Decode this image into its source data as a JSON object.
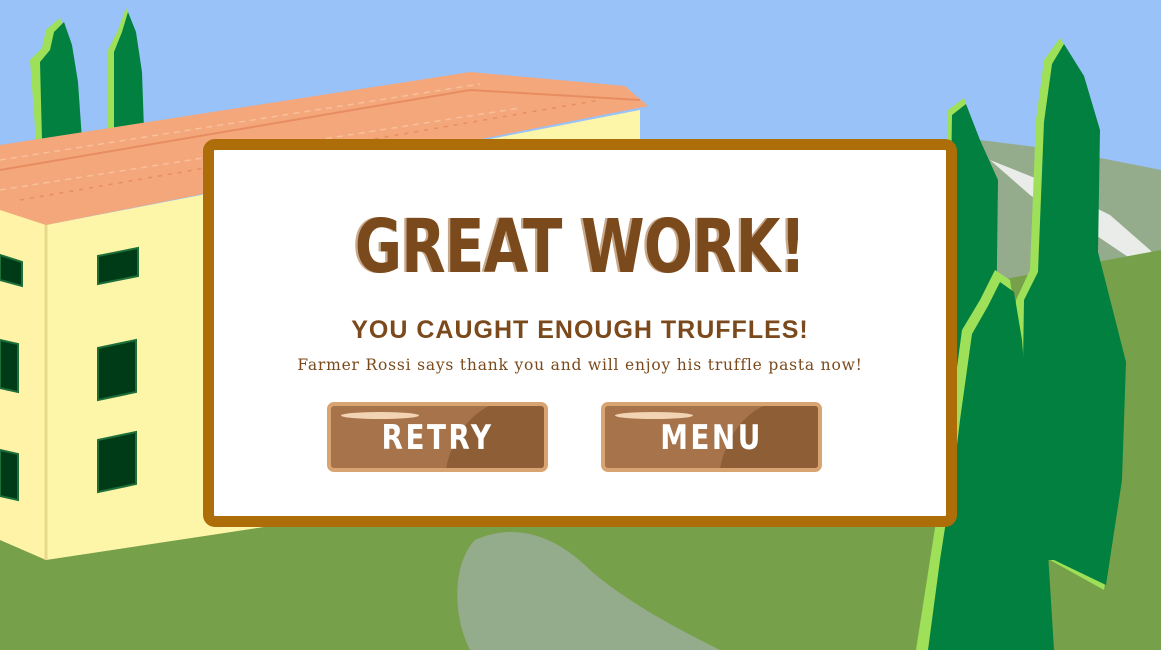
{
  "dialog": {
    "title": "GREAT WORK!",
    "subtitle": "YOU CAUGHT ENOUGH TRUFFLES!",
    "message": "Farmer Rossi says thank you and will enjoy his truffle pasta now!",
    "retry_label": "RETRY",
    "menu_label": "MENU"
  },
  "colors": {
    "sky": "#99c2f9",
    "grass": "#77a04a",
    "dialog_border": "#ad6d09",
    "text_brown": "#7b4a1c",
    "button_fill": "#a7734a",
    "building_wall": "#fdf6a8",
    "roof": "#f3a77a",
    "tree_dark": "#028040",
    "tree_light": "#9ee058"
  }
}
